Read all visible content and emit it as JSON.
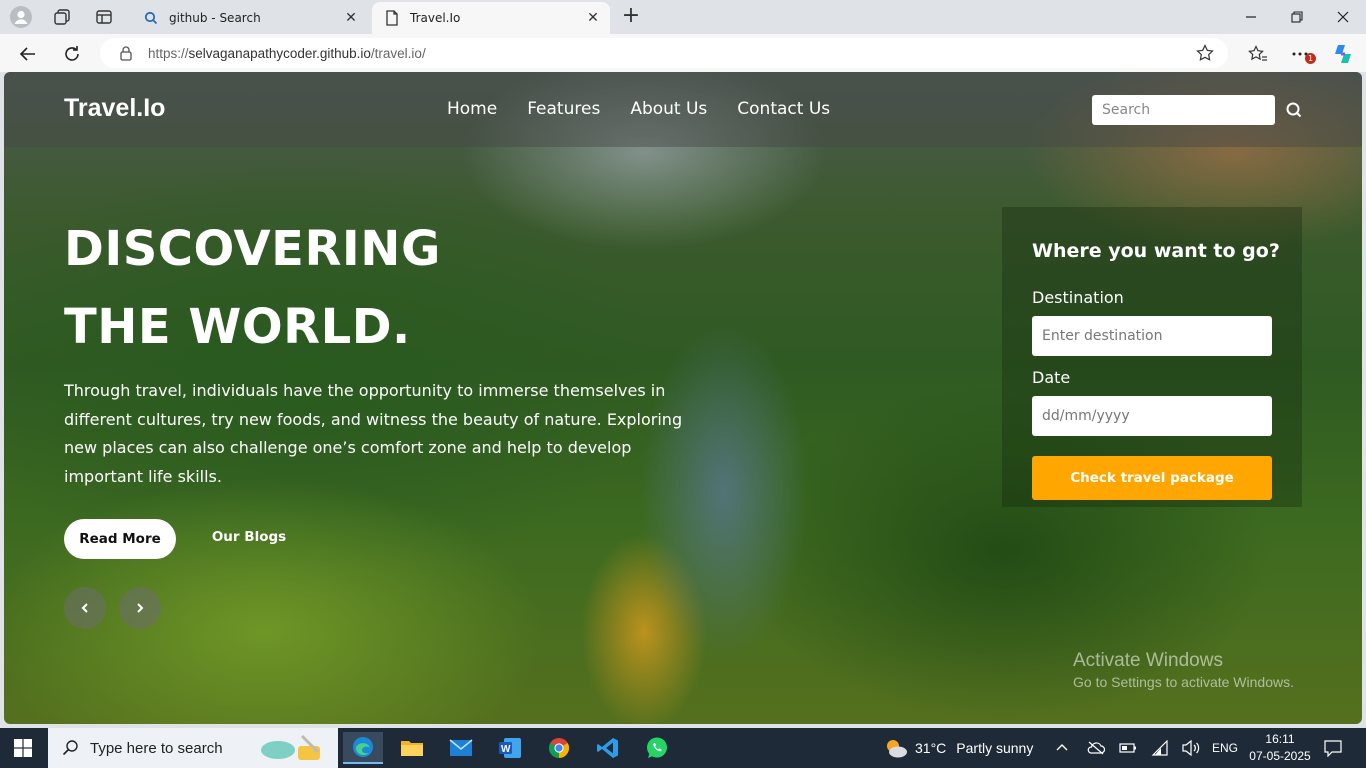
{
  "browser": {
    "tabs": [
      {
        "title": "github - Search",
        "active": false
      },
      {
        "title": "Travel.Io",
        "active": true
      }
    ],
    "address": {
      "scheme": "https://",
      "host": "selvaganapathycoder.github.io",
      "path": "/travel.io/"
    },
    "notification_count": "1"
  },
  "site": {
    "logo": "Travel.Io",
    "nav": [
      "Home",
      "Features",
      "About Us",
      "Contact Us"
    ],
    "search_placeholder": "Search",
    "headline_line1": "DISCOVERING",
    "headline_line2": "THE WORLD.",
    "lead": "Through travel, individuals have the opportunity to immerse themselves in different cultures, try new foods, and witness the beauty of nature. Exploring new places can also challenge one’s comfort zone and help to develop important life skills.",
    "read_more": "Read More",
    "our_blogs": "Our Blogs",
    "booking": {
      "title": "Where you want to go?",
      "destination_label": "Destination",
      "destination_placeholder": "Enter destination",
      "date_label": "Date",
      "date_placeholder": "dd/mm/yyyy",
      "button": "Check travel package"
    },
    "accent_color": "#ffa700"
  },
  "watermark": {
    "line1": "Activate Windows",
    "line2": "Go to Settings to activate Windows."
  },
  "taskbar": {
    "search_placeholder": "Type here to search",
    "weather": {
      "temp": "31°C",
      "desc": "Partly sunny"
    },
    "lang": "ENG",
    "time": "16:11",
    "date": "07-05-2025"
  }
}
